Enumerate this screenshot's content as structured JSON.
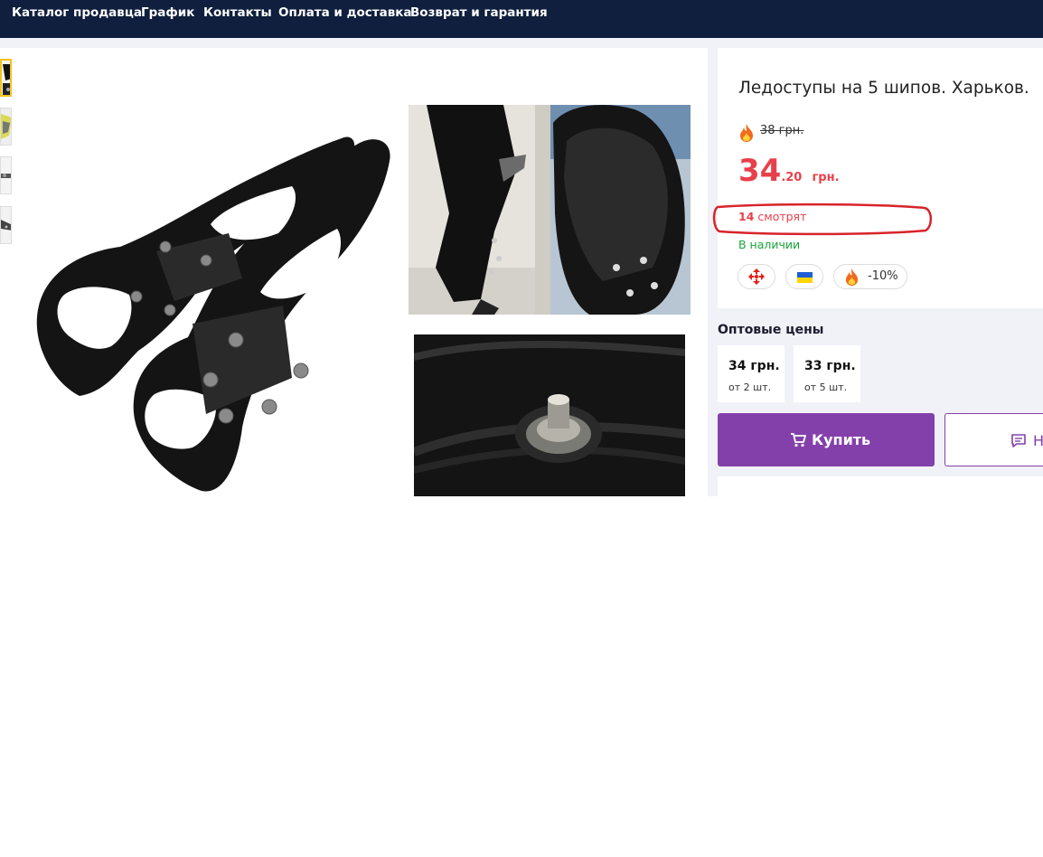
{
  "nav": {
    "items": [
      "Каталог продавца",
      "График",
      "Контакты",
      "Оплата и доставка",
      "Возврат и гарантия"
    ]
  },
  "product": {
    "title": "Ледоступы на 5 шипов. Харьков.",
    "old_price": "38 грн.",
    "price_int": "34",
    "price_frac": ".20",
    "currency": "грн.",
    "viewers_count": "14",
    "viewers_label": "смотрят",
    "availability": "В наличии",
    "badges": {
      "delivery_icon": "nova-poshta-icon",
      "flag_icon": "ukraine-flag-icon",
      "discount_icon": "fire-icon",
      "discount": "-10%"
    }
  },
  "wholesale": {
    "title": "Оптовые цены",
    "tiers": [
      {
        "price": "34 грн.",
        "qty": "от 2 шт."
      },
      {
        "price": "33 грн.",
        "qty": "от 5 шт."
      }
    ]
  },
  "actions": {
    "buy_label": "Купить",
    "message_label": "Н"
  },
  "colors": {
    "nav_bg": "#0f1f3d",
    "accent": "#8440aa",
    "price": "#e8404b",
    "in_stock": "#18a33a",
    "highlight": "#d8232a"
  }
}
